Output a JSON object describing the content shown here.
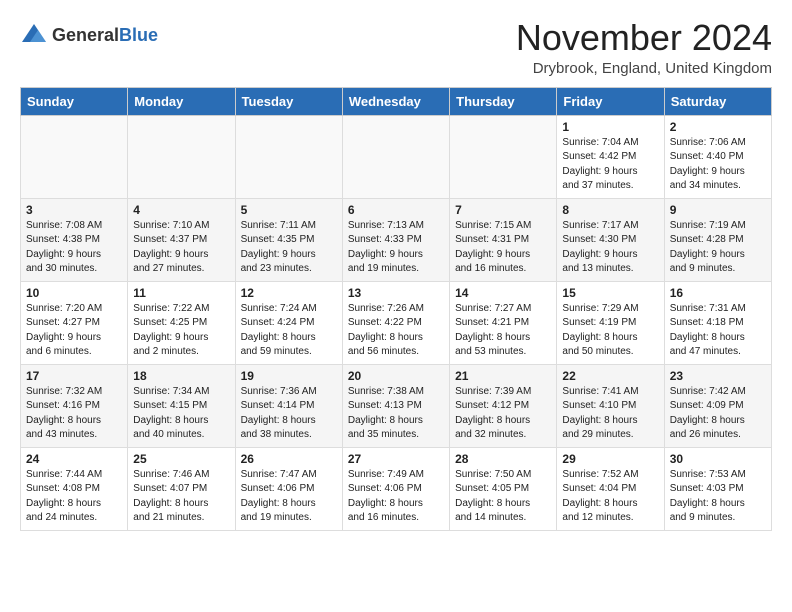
{
  "header": {
    "logo_general": "General",
    "logo_blue": "Blue",
    "month_title": "November 2024",
    "location": "Drybrook, England, United Kingdom"
  },
  "weekdays": [
    "Sunday",
    "Monday",
    "Tuesday",
    "Wednesday",
    "Thursday",
    "Friday",
    "Saturday"
  ],
  "weeks": [
    [
      {
        "day": "",
        "info": ""
      },
      {
        "day": "",
        "info": ""
      },
      {
        "day": "",
        "info": ""
      },
      {
        "day": "",
        "info": ""
      },
      {
        "day": "",
        "info": ""
      },
      {
        "day": "1",
        "info": "Sunrise: 7:04 AM\nSunset: 4:42 PM\nDaylight: 9 hours\nand 37 minutes."
      },
      {
        "day": "2",
        "info": "Sunrise: 7:06 AM\nSunset: 4:40 PM\nDaylight: 9 hours\nand 34 minutes."
      }
    ],
    [
      {
        "day": "3",
        "info": "Sunrise: 7:08 AM\nSunset: 4:38 PM\nDaylight: 9 hours\nand 30 minutes."
      },
      {
        "day": "4",
        "info": "Sunrise: 7:10 AM\nSunset: 4:37 PM\nDaylight: 9 hours\nand 27 minutes."
      },
      {
        "day": "5",
        "info": "Sunrise: 7:11 AM\nSunset: 4:35 PM\nDaylight: 9 hours\nand 23 minutes."
      },
      {
        "day": "6",
        "info": "Sunrise: 7:13 AM\nSunset: 4:33 PM\nDaylight: 9 hours\nand 19 minutes."
      },
      {
        "day": "7",
        "info": "Sunrise: 7:15 AM\nSunset: 4:31 PM\nDaylight: 9 hours\nand 16 minutes."
      },
      {
        "day": "8",
        "info": "Sunrise: 7:17 AM\nSunset: 4:30 PM\nDaylight: 9 hours\nand 13 minutes."
      },
      {
        "day": "9",
        "info": "Sunrise: 7:19 AM\nSunset: 4:28 PM\nDaylight: 9 hours\nand 9 minutes."
      }
    ],
    [
      {
        "day": "10",
        "info": "Sunrise: 7:20 AM\nSunset: 4:27 PM\nDaylight: 9 hours\nand 6 minutes."
      },
      {
        "day": "11",
        "info": "Sunrise: 7:22 AM\nSunset: 4:25 PM\nDaylight: 9 hours\nand 2 minutes."
      },
      {
        "day": "12",
        "info": "Sunrise: 7:24 AM\nSunset: 4:24 PM\nDaylight: 8 hours\nand 59 minutes."
      },
      {
        "day": "13",
        "info": "Sunrise: 7:26 AM\nSunset: 4:22 PM\nDaylight: 8 hours\nand 56 minutes."
      },
      {
        "day": "14",
        "info": "Sunrise: 7:27 AM\nSunset: 4:21 PM\nDaylight: 8 hours\nand 53 minutes."
      },
      {
        "day": "15",
        "info": "Sunrise: 7:29 AM\nSunset: 4:19 PM\nDaylight: 8 hours\nand 50 minutes."
      },
      {
        "day": "16",
        "info": "Sunrise: 7:31 AM\nSunset: 4:18 PM\nDaylight: 8 hours\nand 47 minutes."
      }
    ],
    [
      {
        "day": "17",
        "info": "Sunrise: 7:32 AM\nSunset: 4:16 PM\nDaylight: 8 hours\nand 43 minutes."
      },
      {
        "day": "18",
        "info": "Sunrise: 7:34 AM\nSunset: 4:15 PM\nDaylight: 8 hours\nand 40 minutes."
      },
      {
        "day": "19",
        "info": "Sunrise: 7:36 AM\nSunset: 4:14 PM\nDaylight: 8 hours\nand 38 minutes."
      },
      {
        "day": "20",
        "info": "Sunrise: 7:38 AM\nSunset: 4:13 PM\nDaylight: 8 hours\nand 35 minutes."
      },
      {
        "day": "21",
        "info": "Sunrise: 7:39 AM\nSunset: 4:12 PM\nDaylight: 8 hours\nand 32 minutes."
      },
      {
        "day": "22",
        "info": "Sunrise: 7:41 AM\nSunset: 4:10 PM\nDaylight: 8 hours\nand 29 minutes."
      },
      {
        "day": "23",
        "info": "Sunrise: 7:42 AM\nSunset: 4:09 PM\nDaylight: 8 hours\nand 26 minutes."
      }
    ],
    [
      {
        "day": "24",
        "info": "Sunrise: 7:44 AM\nSunset: 4:08 PM\nDaylight: 8 hours\nand 24 minutes."
      },
      {
        "day": "25",
        "info": "Sunrise: 7:46 AM\nSunset: 4:07 PM\nDaylight: 8 hours\nand 21 minutes."
      },
      {
        "day": "26",
        "info": "Sunrise: 7:47 AM\nSunset: 4:06 PM\nDaylight: 8 hours\nand 19 minutes."
      },
      {
        "day": "27",
        "info": "Sunrise: 7:49 AM\nSunset: 4:06 PM\nDaylight: 8 hours\nand 16 minutes."
      },
      {
        "day": "28",
        "info": "Sunrise: 7:50 AM\nSunset: 4:05 PM\nDaylight: 8 hours\nand 14 minutes."
      },
      {
        "day": "29",
        "info": "Sunrise: 7:52 AM\nSunset: 4:04 PM\nDaylight: 8 hours\nand 12 minutes."
      },
      {
        "day": "30",
        "info": "Sunrise: 7:53 AM\nSunset: 4:03 PM\nDaylight: 8 hours\nand 9 minutes."
      }
    ]
  ]
}
